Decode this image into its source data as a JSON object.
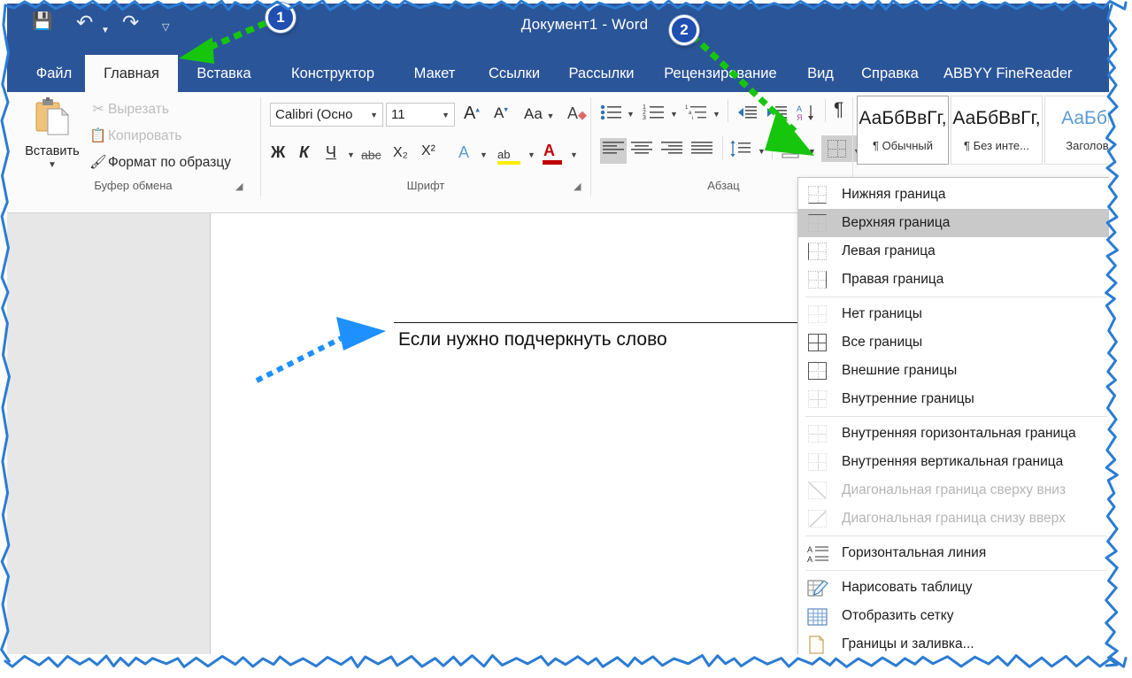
{
  "window": {
    "title": "Документ1  -  Word"
  },
  "quick_access": {
    "save": "save-icon",
    "undo": "undo-icon",
    "redo": "redo-icon",
    "customize": "customize-qat-icon"
  },
  "tabs": [
    {
      "label": "Файл",
      "active": false
    },
    {
      "label": "Главная",
      "active": true
    },
    {
      "label": "Вставка",
      "active": false
    },
    {
      "label": "Конструктор",
      "active": false
    },
    {
      "label": "Макет",
      "active": false
    },
    {
      "label": "Ссылки",
      "active": false
    },
    {
      "label": "Рассылки",
      "active": false
    },
    {
      "label": "Рецензирование",
      "active": false
    },
    {
      "label": "Вид",
      "active": false
    },
    {
      "label": "Справка",
      "active": false
    },
    {
      "label": "ABBYY FineReader",
      "active": false
    }
  ],
  "ribbon": {
    "clipboard": {
      "group_label": "Буфер обмена",
      "paste_label": "Вставить",
      "cut_label": "Вырезать",
      "copy_label": "Копировать",
      "format_painter_label": "Формат по образцу"
    },
    "font": {
      "group_label": "Шрифт",
      "font_name": "Calibri (Осно",
      "font_size": "11",
      "grow_font": "A",
      "shrink_font": "A",
      "change_case": "Aa",
      "clear_formatting": "A",
      "bold": "Ж",
      "italic": "К",
      "underline": "Ч",
      "strikethrough": "abc",
      "subscript": "X₂",
      "superscript": "X²",
      "text_effects": "A",
      "highlight": "ab",
      "font_color": "A"
    },
    "paragraph": {
      "group_label": "Абзац",
      "bullets": "bullets-icon",
      "numbering": "numbering-icon",
      "multilevel": "multilevel-list-icon",
      "decrease_indent": "decrease-indent-icon",
      "increase_indent": "increase-indent-icon",
      "sort": "sort-icon",
      "show_marks": "¶",
      "align_left": "align-left-icon",
      "align_center": "align-center-icon",
      "align_right": "align-right-icon",
      "justify": "justify-icon",
      "line_spacing": "line-spacing-icon",
      "shading": "shading-icon",
      "borders": "borders-icon"
    },
    "styles": [
      {
        "preview": "АаБбВвГг,",
        "name": "¶ Обычный",
        "selected": true,
        "heading": false
      },
      {
        "preview": "АаБбВвГг,",
        "name": "¶ Без инте...",
        "selected": false,
        "heading": false
      },
      {
        "preview": "АаБбВ",
        "name": "Заголово",
        "selected": false,
        "heading": true
      }
    ]
  },
  "borders_menu": {
    "items": [
      {
        "label": "Нижняя граница",
        "icon": "border-bottom-icon",
        "state": "normal",
        "sep_after": false
      },
      {
        "label": "Верхняя граница",
        "icon": "border-top-icon",
        "state": "selected",
        "sep_after": false
      },
      {
        "label": "Левая граница",
        "icon": "border-left-icon",
        "state": "normal",
        "sep_after": false
      },
      {
        "label": "Правая граница",
        "icon": "border-right-icon",
        "state": "normal",
        "sep_after": true
      },
      {
        "label": "Нет границы",
        "icon": "border-none-icon",
        "state": "normal",
        "sep_after": false
      },
      {
        "label": "Все границы",
        "icon": "border-all-icon",
        "state": "normal",
        "sep_after": false
      },
      {
        "label": "Внешние границы",
        "icon": "border-outside-icon",
        "state": "normal",
        "sep_after": false
      },
      {
        "label": "Внутренние границы",
        "icon": "border-inside-icon",
        "state": "normal",
        "sep_after": true
      },
      {
        "label": "Внутренняя горизонтальная граница",
        "icon": "border-inside-horizontal-icon",
        "state": "normal",
        "sep_after": false
      },
      {
        "label": "Внутренняя вертикальная граница",
        "icon": "border-inside-vertical-icon",
        "state": "normal",
        "sep_after": false
      },
      {
        "label": "Диагональная граница сверху вниз",
        "icon": "border-diagonal-down-icon",
        "state": "disabled",
        "sep_after": false
      },
      {
        "label": "Диагональная граница снизу вверх",
        "icon": "border-diagonal-up-icon",
        "state": "disabled",
        "sep_after": true
      },
      {
        "label": "Горизонтальная линия",
        "icon": "horizontal-line-icon",
        "state": "normal",
        "sep_after": true
      },
      {
        "label": "Нарисовать таблицу",
        "icon": "draw-table-icon",
        "state": "normal",
        "sep_after": false
      },
      {
        "label": "Отобразить сетку",
        "icon": "view-gridlines-icon",
        "state": "normal",
        "sep_after": false
      },
      {
        "label": "Границы и заливка...",
        "icon": "borders-and-shading-icon",
        "state": "normal",
        "sep_after": false
      }
    ]
  },
  "document": {
    "body_text": "Если нужно подчеркнуть слово"
  },
  "annotations": [
    {
      "number": "1",
      "target": "home-tab"
    },
    {
      "number": "2",
      "target": "borders-button"
    }
  ],
  "colors": {
    "titlebar": "#2b5599",
    "ribbon_bg": "#fbfbfb",
    "doc_bg": "#e7e7e7",
    "badge": "#1f4fb0",
    "callout_arrow_1": "#16c60c",
    "callout_arrow_2": "#1e90ff",
    "frame": "#2b7cd3",
    "menu_selected": "#c9c9c9"
  }
}
